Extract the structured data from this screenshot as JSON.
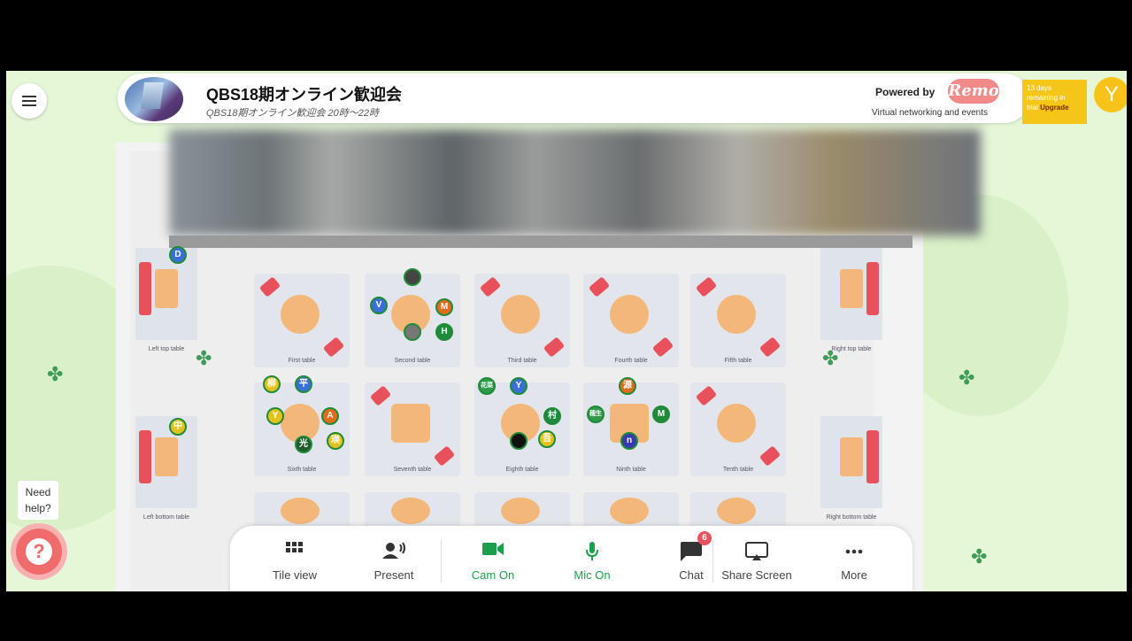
{
  "event": {
    "title": "QBS18期オンライン歓迎会",
    "subtitle": "QBS18期オンライン歓迎会 20時〜22時"
  },
  "branding": {
    "powered_by": "Powered by",
    "logo_text": "Remo",
    "tagline": "Virtual networking and events",
    "accent_color": "#f28a8a"
  },
  "trial": {
    "line1": "13 days",
    "line2": "remaining in",
    "line3": "trial",
    "upgrade": "Upgrade"
  },
  "user": {
    "initial": "Y"
  },
  "help": {
    "line1": "Need",
    "line2": "help?"
  },
  "tables": [
    {
      "label": "First table"
    },
    {
      "label": "Second table"
    },
    {
      "label": "Third table"
    },
    {
      "label": "Fourth table"
    },
    {
      "label": "Fifth table"
    },
    {
      "label": "Sixth table"
    },
    {
      "label": "Seventh table"
    },
    {
      "label": "Eighth table"
    },
    {
      "label": "Ninth table"
    },
    {
      "label": "Tenth table"
    }
  ],
  "side_tables": {
    "left_top": "Left top table",
    "left_bottom": "Left bottom table",
    "right_top": "Right top table",
    "right_bottom": "Right bottom table"
  },
  "avatars": {
    "left_top": "D",
    "second": [
      "V",
      "M",
      "H"
    ],
    "sixth": [
      "柳",
      "平",
      "Y",
      "A",
      "光",
      "瑛"
    ],
    "eighth": [
      "花菜",
      "Y",
      "村",
      "吾"
    ],
    "ninth": [
      "源",
      "穂生",
      "M",
      "n"
    ],
    "left_bottom": "中"
  },
  "toolbar": {
    "tile_view": "Tile view",
    "present": "Present",
    "cam": "Cam On",
    "mic": "Mic On",
    "chat": "Chat",
    "chat_badge": "6",
    "share_screen": "Share Screen",
    "more": "More"
  }
}
